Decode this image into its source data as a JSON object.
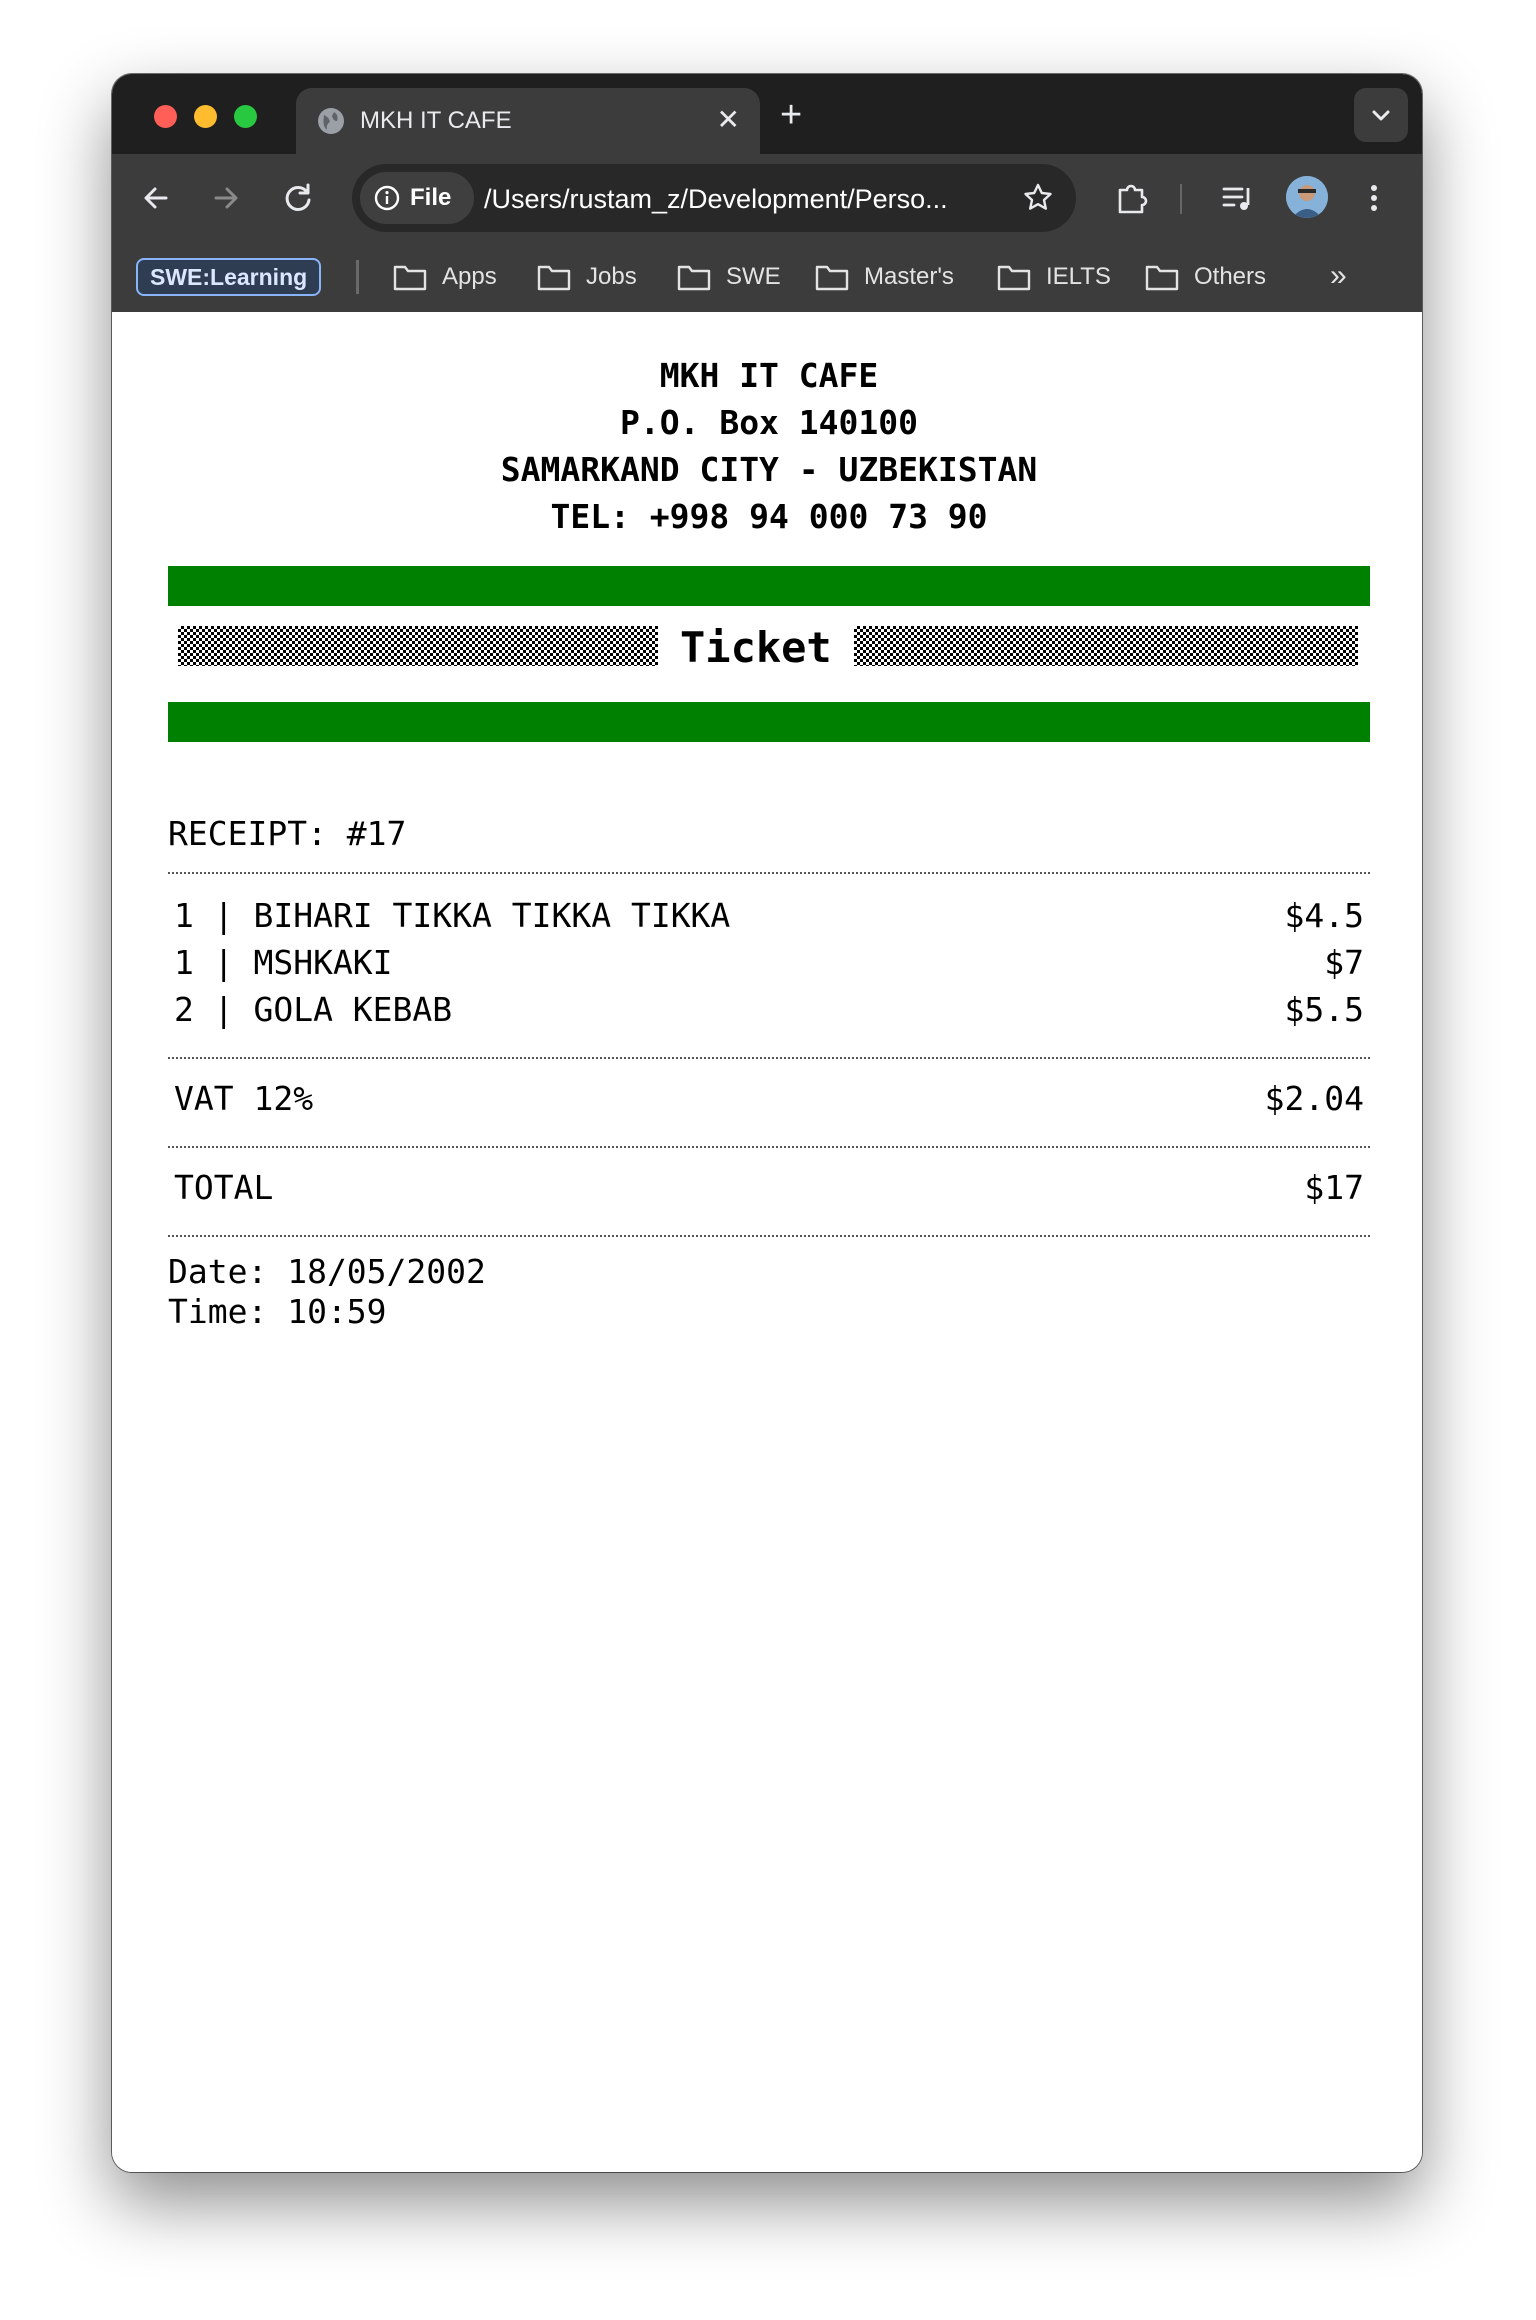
{
  "browser": {
    "tab_title": "MKH IT CAFE",
    "address_chip": "File",
    "url": "/Users/rustam_z/Development/Perso...",
    "tab_group": "SWE:Learning",
    "bookmarks": [
      "Apps",
      "Jobs",
      "SWE",
      "Master's",
      "IELTS",
      "Others"
    ]
  },
  "receipt": {
    "header": [
      "MKH IT CAFE",
      "P.O. Box 140100",
      "SAMARKAND CITY - UZBEKISTAN",
      "TEL: +998 94 000 73 90"
    ],
    "banner_label": "Ticket",
    "receipt_no": "RECEIPT: #17",
    "items": [
      {
        "qty_name": "1 | BIHARI TIKKA TIKKA TIKKA",
        "price": "$4.5"
      },
      {
        "qty_name": "1 | MSHKAKI",
        "price": "$7"
      },
      {
        "qty_name": "2 | GOLA KEBAB",
        "price": "$5.5"
      }
    ],
    "vat_label": "VAT 12%",
    "vat_value": "$2.04",
    "total_label": "TOTAL",
    "total_value": "$17",
    "date": "Date: 18/05/2002",
    "time": "Time: 10:59"
  },
  "colors": {
    "banner_green": "#008000",
    "chrome_dark": "#3c3c3c",
    "tab_strip": "#1f1f1f"
  }
}
